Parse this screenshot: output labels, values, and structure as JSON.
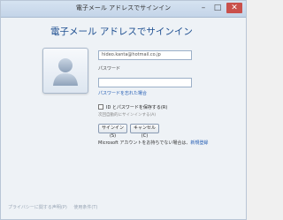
{
  "window": {
    "title": "電子メール アドレスでサインイン",
    "minimize": "–",
    "maximize": "□",
    "close": "✕"
  },
  "heading": "電子メール アドレスでサインイン",
  "email_value": "hideo.kanta@hotmail.co.jp",
  "password_label": "パスワード",
  "forgot_password": "パスワードを忘れた場合",
  "remember_label": "ID とパスワードを保存する(R)",
  "remember_note": "次回自動的にサインインする(A)",
  "buttons": {
    "sign_in": "サインイン(S)",
    "cancel": "キャンセル(C)"
  },
  "signup": {
    "text": "Microsoft アカウントをお持ちでない場合は、",
    "link": "新規登録"
  },
  "footer": {
    "privacy": "プライバシーに関する声明(P)",
    "terms": "使用条件(T)"
  }
}
